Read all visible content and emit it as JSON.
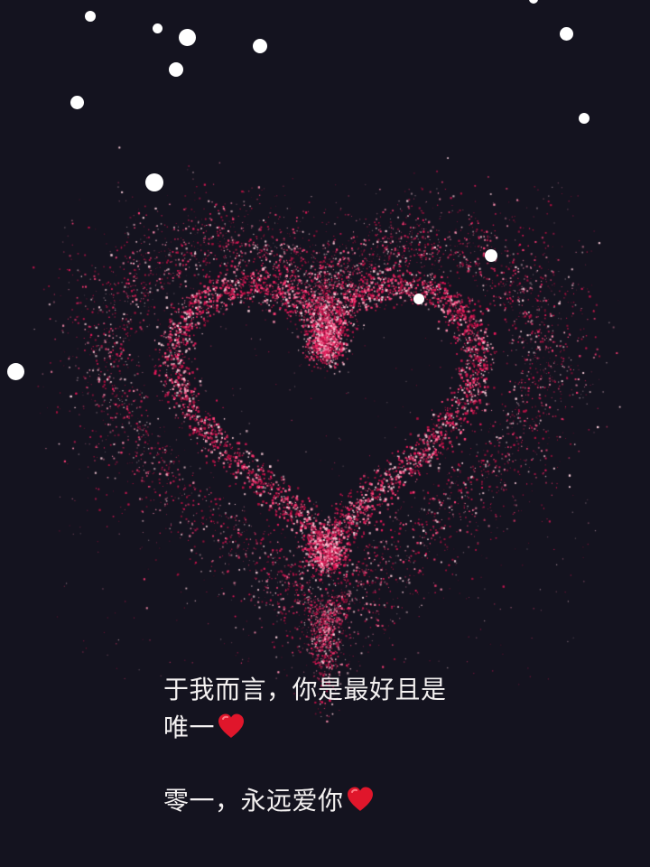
{
  "scene": {
    "background_color": "#14131f",
    "particle_colors": [
      "#e8185a",
      "#ff3d77",
      "#c2124a",
      "#ff8fb0",
      "#ffd0dd",
      "#b0103f"
    ],
    "snow_color": "#ffffff"
  },
  "message": {
    "line1": "于我而言，你是最好且是",
    "line2": "唯一",
    "line2_emoji": "heart-emoji",
    "line3": "零一，永远爱你",
    "line3_emoji": "heart-emoji",
    "emoji_color": "#e0162b"
  }
}
